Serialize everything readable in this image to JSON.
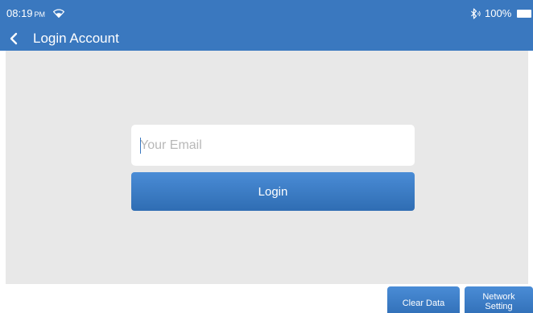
{
  "status_bar": {
    "time": "08:19",
    "ampm": "PM",
    "battery": "100%",
    "icons": [
      "wifi-icon",
      "bluetooth-icon",
      "battery-icon"
    ]
  },
  "title_bar": {
    "title": "Login Account",
    "back_icon": "chevron-left-icon"
  },
  "login_form": {
    "email_placeholder": "Your Email",
    "email_value": "",
    "login_label": "Login"
  },
  "bottom_actions": {
    "clear_data_label": "Clear Data",
    "network_setting_line1": "Network",
    "network_setting_line2": "Setting"
  },
  "colors": {
    "accent": "#3a78bf",
    "content_bg": "#e8e8e8"
  }
}
